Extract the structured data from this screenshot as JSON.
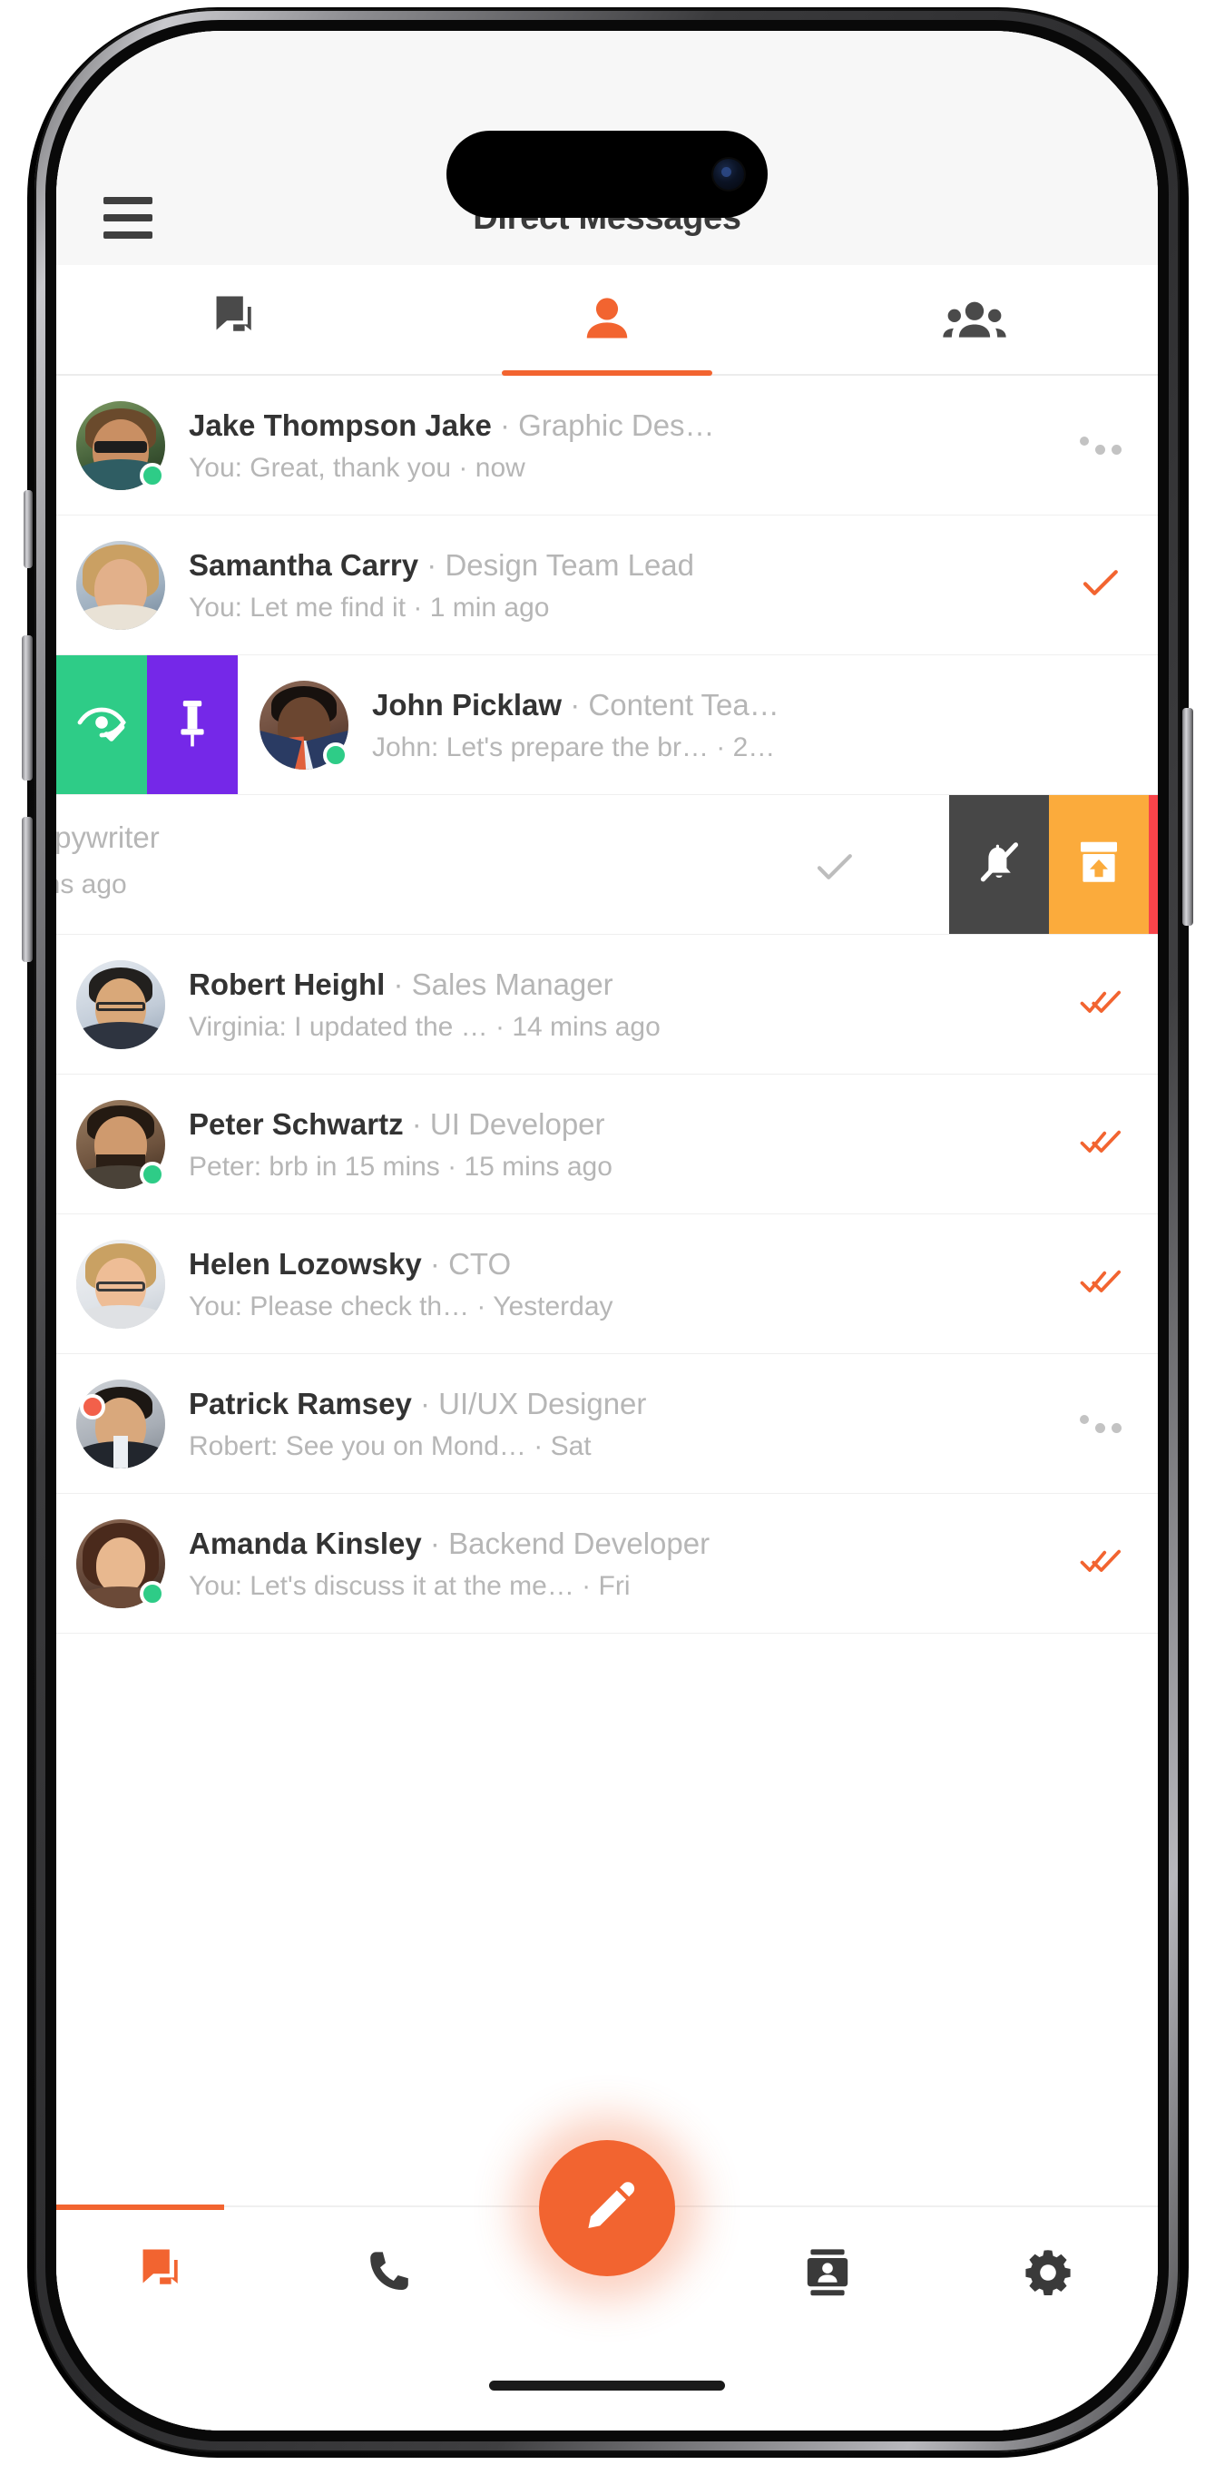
{
  "colors": {
    "accent": "#f26430",
    "online": "#2ecc87",
    "busy": "#f2604a",
    "pin": "#7528e8",
    "read": "#2ecc87",
    "mute": "#474747",
    "archive": "#fbab3c",
    "delete": "#f8444a",
    "title": "#3a3a3a",
    "subtle": "#b6b6b6"
  },
  "appbar": {
    "title": "Direct Messages",
    "menu_icon": "hamburger-icon"
  },
  "tabs": [
    {
      "id": "chats",
      "icon": "chat-bubbles-icon",
      "active": false
    },
    {
      "id": "direct",
      "icon": "person-icon",
      "active": true
    },
    {
      "id": "groups",
      "icon": "people-group-icon",
      "active": false
    }
  ],
  "swipe_actions": {
    "left": [
      {
        "id": "mark-read",
        "icon": "eye-check-icon",
        "color": "#2ecc87"
      },
      {
        "id": "pin",
        "icon": "pin-icon",
        "color": "#7528e8"
      }
    ],
    "right": [
      {
        "id": "mute",
        "icon": "bell-slash-icon",
        "color": "#474747"
      },
      {
        "id": "archive",
        "icon": "archive-icon",
        "color": "#fbab3c"
      },
      {
        "id": "delete",
        "icon": "trash-icon",
        "color": "#f8444a"
      }
    ]
  },
  "conversations": [
    {
      "name": "Jake Thompson Jake",
      "role": "Graphic Des…",
      "preview": "You: Great, thank you",
      "time": "now",
      "status": "online",
      "meta_icon": "three-dots-icon"
    },
    {
      "name": "Samantha Carry",
      "role": "Design Team Lead",
      "preview": "You: Let me find it",
      "time": "1 min ago",
      "status": "none",
      "meta_icon": "single-check-icon"
    },
    {
      "name": "John Picklaw",
      "role": "Content Tea…",
      "preview": "John: Let's prepare the br…",
      "time": "2…",
      "status": "online",
      "meta_icon": "none",
      "swiped": true
    },
    {
      "name": "",
      "role": "Copywriter",
      "preview": "",
      "time": "mins ago",
      "status": "none",
      "meta_icon": "single-check-icon",
      "partial": true
    },
    {
      "name": "Robert Heighl",
      "role": "Sales Manager",
      "preview": "Virginia: I updated the …",
      "time": "14 mins ago",
      "status": "none",
      "meta_icon": "double-check-icon"
    },
    {
      "name": "Peter Schwartz",
      "role": "UI Developer",
      "preview": "Peter: brb in 15 mins",
      "time": "15 mins ago",
      "status": "online",
      "meta_icon": "double-check-icon"
    },
    {
      "name": "Helen Lozowsky",
      "role": "CTO",
      "preview": "You: Please check th…",
      "time": "Yesterday",
      "status": "none",
      "meta_icon": "double-check-icon"
    },
    {
      "name": "Patrick Ramsey",
      "role": "UI/UX Designer",
      "preview": "Robert: See you on Mond…",
      "time": "Sat",
      "status": "busy",
      "meta_icon": "three-dots-icon"
    },
    {
      "name": "Amanda Kinsley",
      "role": "Backend Developer",
      "preview": "You: Let's discuss it at the me…",
      "time": "Fri",
      "status": "online",
      "meta_icon": "double-check-icon"
    }
  ],
  "bottom_nav": [
    {
      "id": "messages",
      "icon": "chat-bubbles-icon",
      "active": true
    },
    {
      "id": "calls",
      "icon": "phone-icon",
      "active": false
    },
    {
      "id": "contacts",
      "icon": "contact-card-icon",
      "active": false
    },
    {
      "id": "settings",
      "icon": "gear-icon",
      "active": false
    }
  ],
  "fab": {
    "icon": "compose-pencil-icon",
    "label": "Compose"
  },
  "separators": {
    "dot": " · "
  }
}
